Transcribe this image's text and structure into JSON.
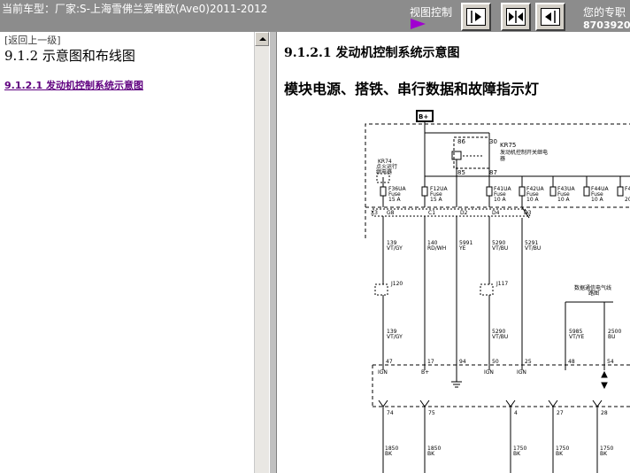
{
  "header": {
    "vehicle_label": "当前车型：厂家:S-上海雪佛兰爱唯欧(Ave0)2011-2012",
    "view_control_label": "视图控制",
    "user_label": "您的专职",
    "user_id": "8703920"
  },
  "sidebar": {
    "back_link": "[返回上一级]",
    "heading": "9.1.2 示意图和布线图",
    "link": "9.1.2.1 发动机控制系统示意图"
  },
  "content": {
    "section_title": "9.1.2.1 发动机控制系统示意图",
    "subtitle": "模块电源、搭铁、串行数据和故障指示灯"
  },
  "diagram": {
    "battery_label": "B+",
    "relay_pin_86": "86",
    "relay_pin_30": "30",
    "relay_pin_85": "85",
    "relay_pin_87": "87",
    "relay_id": "KR75",
    "relay_desc_1": "发动机控制开关继电",
    "relay_desc_2": "器",
    "ign_relay_id": "KR74",
    "ign_relay_desc_1": "点火运行",
    "ign_relay_desc_2": "继电器",
    "fuse_word": "Fuse",
    "fuses": [
      {
        "name": "F36UA",
        "rating": "15 A"
      },
      {
        "name": "F12UA",
        "rating": "15 A"
      },
      {
        "name": "F41UA",
        "rating": "10 A"
      },
      {
        "name": "F42UA",
        "rating": "10 A"
      },
      {
        "name": "F43UA",
        "rating": "10 A"
      },
      {
        "name": "F44UA",
        "rating": "10 A"
      },
      {
        "name": "F4",
        "rating": "20"
      }
    ],
    "connector_x3": "X3",
    "pins_top": [
      "G8",
      "C1",
      "D2",
      "D4",
      "D3"
    ],
    "wires_top": [
      {
        "num": "139",
        "color": "VT/GY"
      },
      {
        "num": "140",
        "color": "RD/WH"
      },
      {
        "num": "5991",
        "color": "YE"
      },
      {
        "num": "5290",
        "color": "VT/BU"
      },
      {
        "num": "5291",
        "color": "VT/BU"
      }
    ],
    "splice_j120": "J120",
    "splice_j117": "J117",
    "data_link_1": "数据通信电气线",
    "data_link_2": "路图",
    "wires_mid": [
      {
        "num": "139",
        "color": "VT/GY"
      },
      {
        "num": "5290",
        "color": "VT/BU"
      },
      {
        "num": "5985",
        "color": "VT/YE"
      },
      {
        "num": "2500",
        "color": "BU"
      }
    ],
    "ecm_pins": [
      "47",
      "17",
      "94",
      "50",
      "25",
      "48",
      "54"
    ],
    "ecm_labels": [
      "IGN",
      "B+",
      "IGN",
      "IGN"
    ],
    "ground_pins": [
      "74",
      "75",
      "4",
      "27",
      "28"
    ],
    "ground_wires": [
      {
        "num": "1850",
        "color": "BK"
      },
      {
        "num": "1850",
        "color": "BK"
      },
      {
        "num": "1750",
        "color": "BK"
      },
      {
        "num": "1750",
        "color": "BK"
      },
      {
        "num": "1750",
        "color": "BK"
      }
    ]
  }
}
